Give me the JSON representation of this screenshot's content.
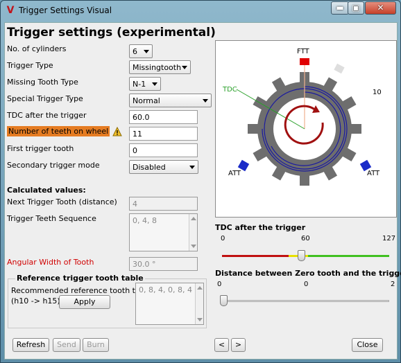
{
  "window": {
    "title": "Trigger Settings Visual"
  },
  "heading": "Trigger settings (experimental)",
  "fields": {
    "cylinders": {
      "label": "No. of cylinders",
      "value": "6"
    },
    "trigger_type": {
      "label": "Trigger Type",
      "value": "Missingtooth"
    },
    "missing_tooth_type": {
      "label": "Missing Tooth Type",
      "value": "N-1"
    },
    "special_trigger_type": {
      "label": "Special Trigger Type",
      "value": "Normal"
    },
    "tdc_after_trigger": {
      "label": "TDC after the trigger",
      "value": "60.0"
    },
    "teeth_on_wheel": {
      "label": "Number of teeth on wheel",
      "value": "11"
    },
    "first_trigger_tooth": {
      "label": "First trigger tooth",
      "value": "0"
    },
    "secondary_trigger_mode": {
      "label": "Secondary trigger mode",
      "value": "Disabled"
    }
  },
  "calculated": {
    "title": "Calculated values:",
    "next_trigger_tooth": {
      "label": "Next Trigger Tooth (distance)",
      "value": "4"
    },
    "teeth_sequence": {
      "label": "Trigger Teeth Sequence",
      "value": "0, 4, 8"
    },
    "angular_width": {
      "label": "Angular Width of Tooth",
      "value": "30.0 °"
    }
  },
  "reference": {
    "title": "Reference trigger tooth table",
    "label_line1": "Recommended reference tooth table",
    "label_line2": "(h10 -> h15)",
    "apply": "Apply",
    "value": "0, 8, 4, 0, 8, 4"
  },
  "visual": {
    "ftt": "FTT",
    "tdc": "TDC",
    "att_left": "ATT",
    "att_right": "ATT",
    "tooth_number": "10",
    "colors": {
      "wheel": "#6e6e6e",
      "ftt": "#e00000",
      "att": "#1a2bc8",
      "tdc_line": "#2aa02a",
      "arrow": "#a01010",
      "rings": "#1a1aa0"
    }
  },
  "tdc_slider": {
    "title": "TDC after the trigger",
    "min": "0",
    "mid": "60",
    "max": "127",
    "value": 60
  },
  "distance_slider": {
    "title": "Distance between Zero tooth and the trigger",
    "min": "0",
    "mid": "0",
    "max": "2",
    "value": 0
  },
  "buttons": {
    "refresh": "Refresh",
    "send": "Send",
    "burn": "Burn",
    "prev": "<",
    "next": ">",
    "close": "Close"
  }
}
